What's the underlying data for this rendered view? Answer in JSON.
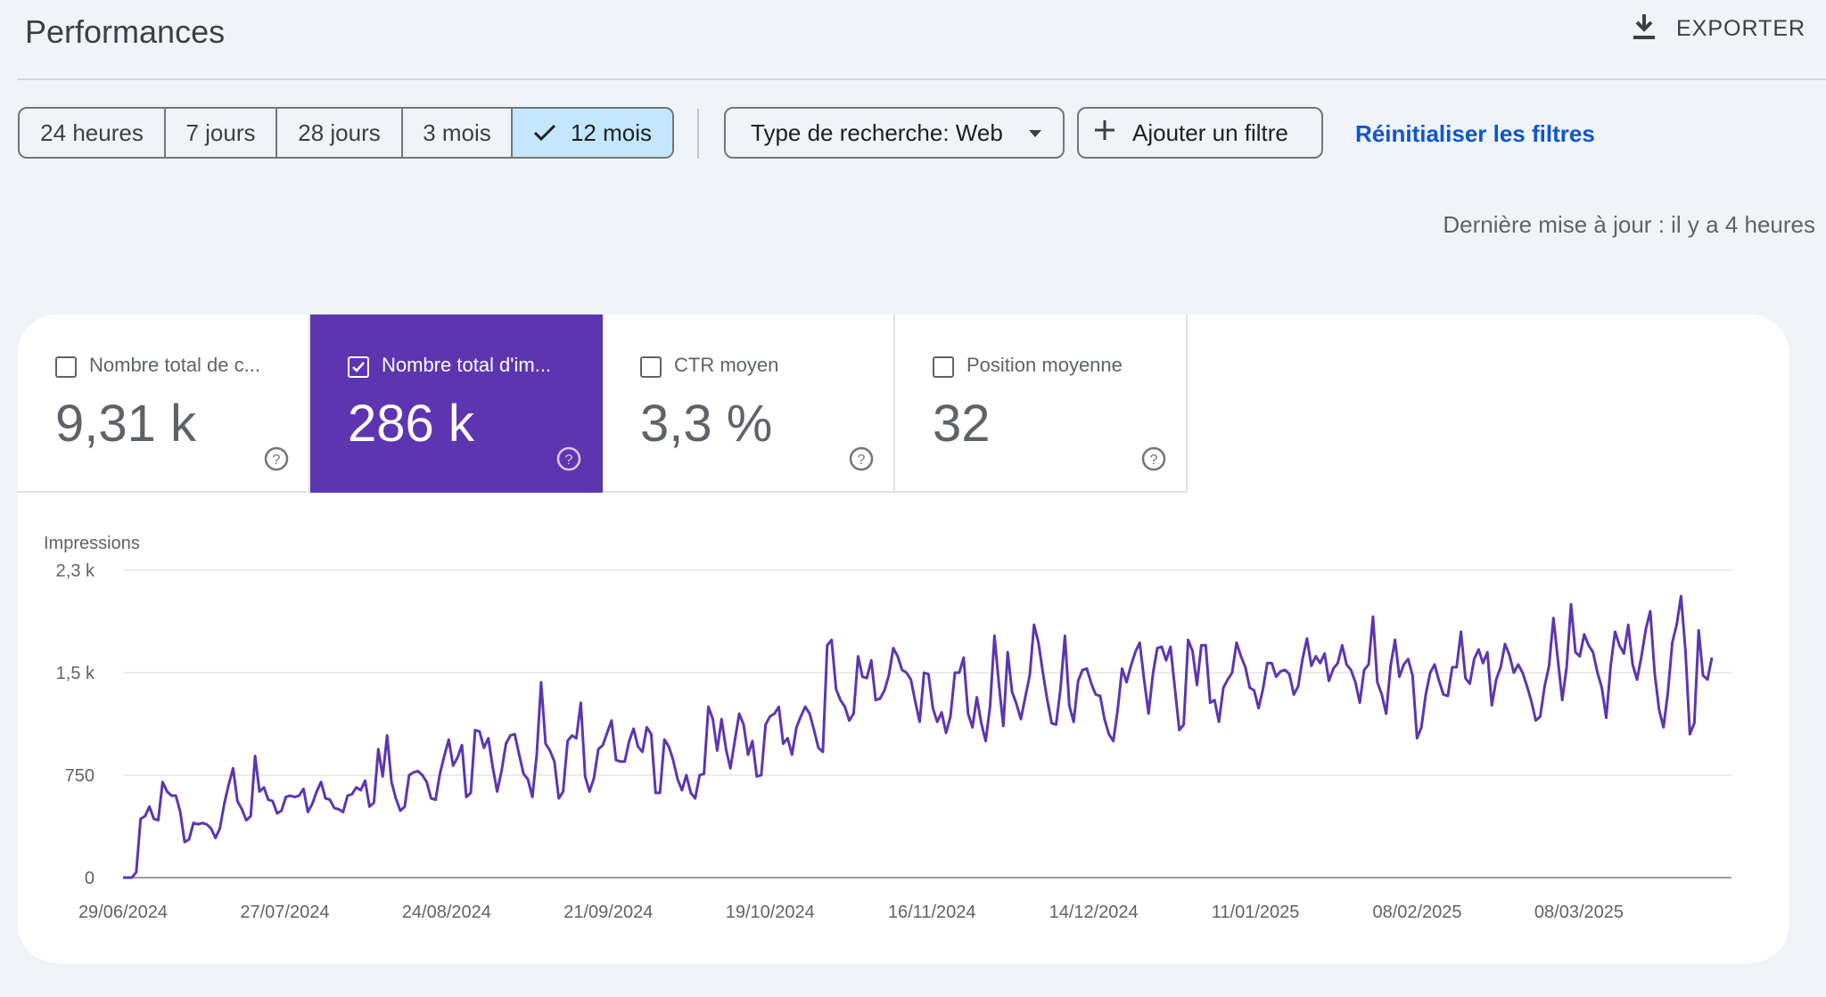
{
  "header": {
    "title": "Performances",
    "export_label": "EXPORTER"
  },
  "filters": {
    "date_ranges": [
      {
        "label": "24 heures",
        "selected": false
      },
      {
        "label": "7 jours",
        "selected": false
      },
      {
        "label": "28 jours",
        "selected": false
      },
      {
        "label": "3 mois",
        "selected": false
      },
      {
        "label": "12 mois",
        "selected": true
      }
    ],
    "search_type": "Type de recherche: Web",
    "add_filter": "Ajouter un filtre",
    "reset": "Réinitialiser les filtres"
  },
  "last_update": "Dernière mise à jour : il y a 4 heures",
  "metrics": [
    {
      "label": "Nombre total de c...",
      "value": "9,31 k",
      "checked": false
    },
    {
      "label": "Nombre total d'im...",
      "value": "286 k",
      "checked": true
    },
    {
      "label": "CTR moyen",
      "value": "3,3 %",
      "checked": false
    },
    {
      "label": "Position moyenne",
      "value": "32",
      "checked": false
    }
  ],
  "colors": {
    "accent": "#5e35b1",
    "line": "#5e35b1",
    "link": "#0b57d0",
    "selected_segment": "#c2e7ff",
    "background": "#f0f3f8"
  },
  "icons": {
    "export": "download-icon",
    "check": "check-icon",
    "dropdown": "caret-down-icon",
    "add": "plus-icon",
    "help": "help-circle-icon"
  },
  "chart_data": {
    "type": "line",
    "ylabel": "Impressions",
    "yticks": [
      {
        "value": 0,
        "label": "0"
      },
      {
        "value": 750,
        "label": "750"
      },
      {
        "value": 1500,
        "label": "1,5 k"
      },
      {
        "value": 2250,
        "label": "2,3 k"
      }
    ],
    "ylim": [
      0,
      2250
    ],
    "xticks": [
      "29/06/2024",
      "27/07/2024",
      "24/08/2024",
      "21/09/2024",
      "19/10/2024",
      "16/11/2024",
      "14/12/2024",
      "11/01/2025",
      "08/02/2025",
      "08/03/2025"
    ],
    "x_start": "2024-06-29",
    "x_end": "2025-03-31",
    "grid": true,
    "series": [
      {
        "values": [
          0,
          0,
          0,
          40,
          430,
          450,
          520,
          430,
          420,
          700,
          630,
          600,
          600,
          480,
          260,
          280,
          400,
          390,
          400,
          390,
          360,
          290,
          360,
          540,
          680,
          800,
          560,
          500,
          420,
          450,
          890,
          630,
          660,
          570,
          560,
          470,
          490,
          590,
          600,
          590,
          600,
          650,
          480,
          540,
          630,
          700,
          580,
          570,
          510,
          500,
          480,
          600,
          610,
          660,
          640,
          710,
          520,
          550,
          940,
          740,
          1040,
          700,
          580,
          490,
          520,
          750,
          770,
          780,
          750,
          700,
          580,
          570,
          760,
          890,
          1010,
          820,
          880,
          970,
          590,
          620,
          1080,
          1070,
          950,
          1020,
          810,
          630,
          780,
          980,
          1040,
          1050,
          900,
          760,
          720,
          590,
          900,
          1430,
          980,
          930,
          850,
          580,
          630,
          1000,
          1040,
          1020,
          1280,
          740,
          630,
          730,
          940,
          970,
          1060,
          1150,
          860,
          850,
          850,
          1000,
          1090,
          960,
          920,
          1100,
          1050,
          620,
          620,
          1010,
          960,
          860,
          720,
          640,
          750,
          620,
          580,
          750,
          760,
          1250,
          1160,
          930,
          1160,
          940,
          800,
          1000,
          1200,
          1120,
          900,
          1000,
          740,
          750,
          1120,
          1180,
          1200,
          1250,
          980,
          1020,
          900,
          1100,
          1180,
          1250,
          1200,
          1080,
          950,
          920,
          1700,
          1740,
          1380,
          1300,
          1250,
          1150,
          1200,
          1620,
          1470,
          1460,
          1590,
          1300,
          1310,
          1370,
          1480,
          1680,
          1620,
          1520,
          1500,
          1450,
          1290,
          1140,
          1500,
          1490,
          1240,
          1140,
          1210,
          1060,
          1180,
          1500,
          1500,
          1610,
          1200,
          1100,
          1320,
          1130,
          1000,
          1250,
          1770,
          1420,
          1110,
          1650,
          1360,
          1270,
          1160,
          1320,
          1480,
          1850,
          1720,
          1500,
          1300,
          1130,
          1120,
          1380,
          1770,
          1260,
          1140,
          1440,
          1520,
          1530,
          1420,
          1340,
          1330,
          1160,
          1050,
          1000,
          1230,
          1530,
          1430,
          1550,
          1650,
          1720,
          1450,
          1200,
          1490,
          1680,
          1690,
          1590,
          1690,
          1380,
          1080,
          1120,
          1740,
          1660,
          1410,
          1700,
          1700,
          1280,
          1300,
          1140,
          1390,
          1450,
          1500,
          1720,
          1620,
          1540,
          1390,
          1370,
          1240,
          1380,
          1570,
          1570,
          1470,
          1510,
          1520,
          1490,
          1340,
          1400,
          1600,
          1750,
          1550,
          1620,
          1570,
          1640,
          1440,
          1530,
          1570,
          1700,
          1560,
          1520,
          1430,
          1280,
          1520,
          1560,
          1910,
          1430,
          1340,
          1200,
          1550,
          1740,
          1470,
          1560,
          1600,
          1480,
          1020,
          1100,
          1340,
          1500,
          1560,
          1440,
          1340,
          1330,
          1540,
          1540,
          1800,
          1460,
          1420,
          1600,
          1670,
          1570,
          1650,
          1260,
          1450,
          1540,
          1710,
          1630,
          1500,
          1560,
          1500,
          1400,
          1290,
          1150,
          1180,
          1400,
          1550,
          1900,
          1600,
          1300,
          1540,
          2000,
          1650,
          1620,
          1780,
          1700,
          1650,
          1500,
          1390,
          1170,
          1550,
          1800,
          1700,
          1640,
          1850,
          1560,
          1450,
          1620,
          1820,
          1950,
          1500,
          1230,
          1100,
          1350,
          1720,
          1850,
          2060,
          1660,
          1050,
          1130,
          1810,
          1480,
          1450,
          1610
        ]
      }
    ]
  }
}
